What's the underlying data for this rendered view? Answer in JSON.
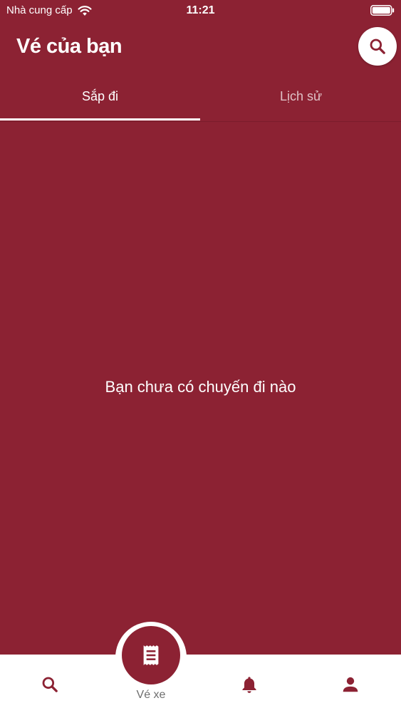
{
  "status_bar": {
    "carrier": "Nhà cung cấp",
    "time": "11:21",
    "wifi_icon": "wifi-icon",
    "battery_icon": "battery-icon"
  },
  "header": {
    "title": "Vé của bạn",
    "search_icon": "search-icon"
  },
  "tabs": [
    {
      "label": "Sắp đi",
      "active": true
    },
    {
      "label": "Lịch sử",
      "active": false
    }
  ],
  "main": {
    "empty_message": "Bạn chưa có chuyến đi nào"
  },
  "bottom_nav": {
    "items": [
      {
        "icon": "search-icon",
        "label": ""
      },
      {
        "icon": "receipt-icon",
        "label": "Vé xe",
        "active": true
      },
      {
        "icon": "bell-icon",
        "label": ""
      },
      {
        "icon": "user-icon",
        "label": ""
      }
    ]
  },
  "colors": {
    "primary": "#8c2233",
    "surface": "#ffffff",
    "nav_label": "#6e6e6e"
  }
}
